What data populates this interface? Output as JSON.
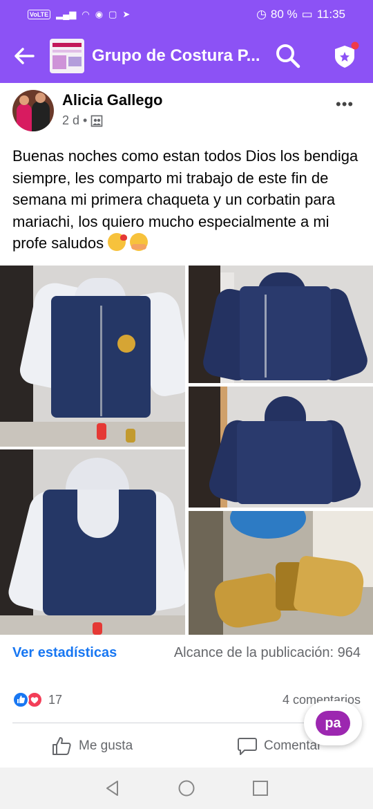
{
  "status_bar": {
    "carrier": "VoLTE",
    "battery": "80 %",
    "time": "11:35"
  },
  "app_bar": {
    "title": "Grupo de Costura P...",
    "group_thumbnail_text": "HORARIO",
    "accent": "#8c52f5"
  },
  "post": {
    "author": "Alicia Gallego",
    "time": "2 d",
    "separator": "•",
    "text": "Buenas noches como estan todos Dios los bendiga siempre, les comparto mi trabajo de este fin de semana mi primera chaqueta y un corbatin para mariachi, los quiero mucho especialmente a mi profe saludos",
    "photos": [
      "jacket-front-photo",
      "jacket-open-photo",
      "jacket-back-photo",
      "jacket-hood-photo",
      "bow-tie-photo"
    ]
  },
  "stats": {
    "link": "Ver estadísticas",
    "reach": "Alcance de la publicación: 964"
  },
  "reactions": {
    "count": "17",
    "comments": "4 comentarios"
  },
  "actions": {
    "like": "Me gusta",
    "comment": "Comentar"
  },
  "fab": {
    "label": "pa"
  },
  "colors": {
    "link": "#1877f2",
    "secondary_text": "#65676b",
    "navy": "#1f2f5c"
  }
}
